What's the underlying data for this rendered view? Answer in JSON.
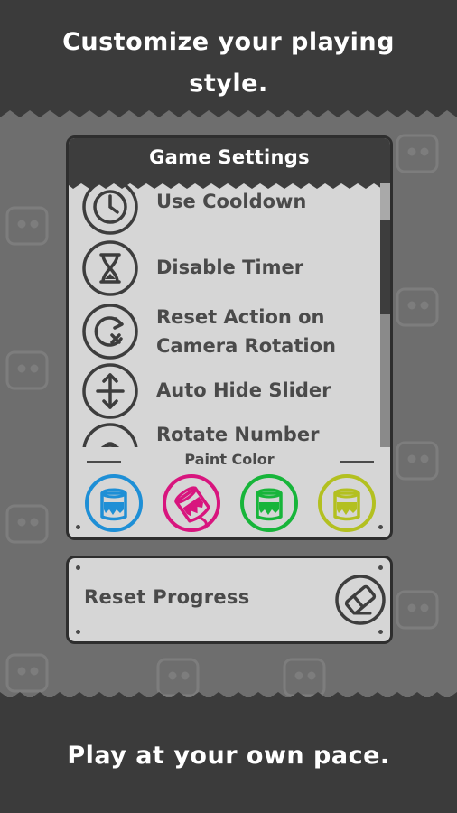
{
  "promo": {
    "headline_top": "Customize your playing\nstyle.",
    "headline_bottom": "Play at your own pace."
  },
  "settings": {
    "title": "Game Settings",
    "items": [
      {
        "label": "Use Cooldown",
        "icon": "clock-icon"
      },
      {
        "label": "Disable Timer",
        "icon": "hourglass-icon"
      },
      {
        "label": "Reset Action on\nCamera Rotation",
        "icon": "rotate-reset-icon"
      },
      {
        "label": "Auto Hide Slider",
        "icon": "slider-arrows-icon"
      },
      {
        "label": "Rotate Number",
        "icon": "rotate-number-icon"
      }
    ],
    "paint_color_label": "Paint Color",
    "paint_colors": [
      {
        "name": "blue",
        "color": "#1e8fd6",
        "selected": false
      },
      {
        "name": "magenta",
        "color": "#d8157e",
        "selected": true
      },
      {
        "name": "green",
        "color": "#17b53a",
        "selected": false
      },
      {
        "name": "yellow-green",
        "color": "#b3c020",
        "selected": false
      }
    ]
  },
  "reset": {
    "label": "Reset Progress",
    "icon": "eraser-icon"
  },
  "colors": {
    "dark_band": "#3b3b3b",
    "mid_background": "#6e6e6e",
    "panel": "#d6d6d6",
    "text_dark": "#4a4a4a"
  }
}
